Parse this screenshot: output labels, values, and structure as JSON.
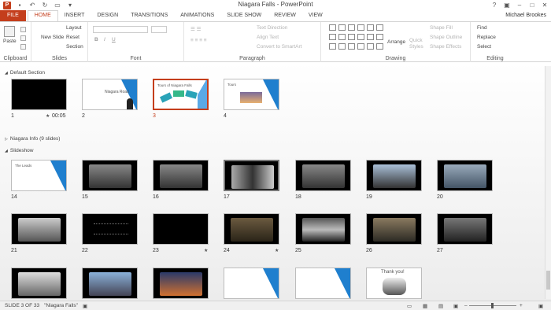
{
  "window": {
    "title": "Niagara Falls - PowerPoint",
    "user": "Michael Brookes"
  },
  "tabs": [
    "FILE",
    "HOME",
    "INSERT",
    "DESIGN",
    "TRANSITIONS",
    "ANIMATIONS",
    "SLIDE SHOW",
    "REVIEW",
    "VIEW"
  ],
  "active_tab": "HOME",
  "ribbon": {
    "clipboard": {
      "label": "Clipboard",
      "paste": "Paste"
    },
    "slides": {
      "label": "Slides",
      "new_slide": "New Slide",
      "layout": "Layout",
      "reset": "Reset",
      "section": "Section"
    },
    "font": {
      "label": "Font"
    },
    "paragraph": {
      "label": "Paragraph",
      "text_direction": "Text Direction",
      "align_text": "Align Text",
      "convert": "Convert to SmartArt"
    },
    "drawing": {
      "label": "Drawing",
      "arrange": "Arrange",
      "quick_styles": "Quick Styles",
      "shape_fill": "Shape Fill",
      "shape_outline": "Shape Outline",
      "shape_effects": "Shape Effects"
    },
    "editing": {
      "label": "Editing",
      "find": "Find",
      "replace": "Replace",
      "select": "Select"
    }
  },
  "sections": {
    "default": "Default Section",
    "niagara": "Niagara Info (9 slides)",
    "slideshow": "Slideshow"
  },
  "slides": [
    {
      "n": "1",
      "duration": "00:05"
    },
    {
      "n": "2",
      "text": "Niagara Road"
    },
    {
      "n": "3",
      "text": "Tours of Niagara Falls"
    },
    {
      "n": "4",
      "text": "Tours"
    },
    {
      "n": "14",
      "text": "The Leads"
    },
    {
      "n": "15"
    },
    {
      "n": "16"
    },
    {
      "n": "17"
    },
    {
      "n": "18"
    },
    {
      "n": "19"
    },
    {
      "n": "20"
    },
    {
      "n": "21"
    },
    {
      "n": "22"
    },
    {
      "n": "23"
    },
    {
      "n": "24"
    },
    {
      "n": "25"
    },
    {
      "n": "26"
    },
    {
      "n": "27"
    },
    {
      "text": "Thank you!"
    }
  ],
  "status": {
    "slide": "SLIDE 3 OF 33",
    "name": "\"Niagara Falls\""
  },
  "colors": {
    "accent": "#c43e1c",
    "selected_border": "#c43e1c"
  }
}
